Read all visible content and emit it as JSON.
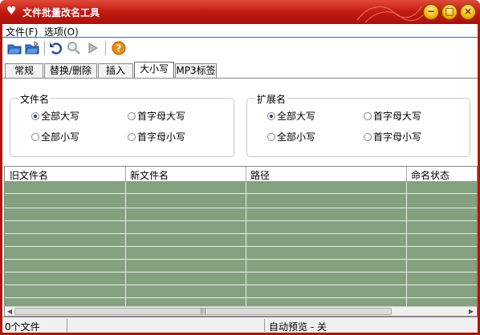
{
  "window": {
    "title": "文件批量改名工具"
  },
  "titlebar_buttons": [
    {
      "name": "minimize-button",
      "glyph": "−"
    },
    {
      "name": "maximize-button",
      "glyph": "□"
    },
    {
      "name": "close-button",
      "glyph": "×"
    }
  ],
  "menu": {
    "file": "文件(F)",
    "options": "选项(O)"
  },
  "toolbar": {
    "icons": [
      "open-folder-icon",
      "open-folder-icon",
      "undo-icon",
      "search-icon",
      "play-icon",
      "help-icon"
    ]
  },
  "tabs": [
    "常规",
    "替换/删除",
    "插入",
    "大小写",
    "MP3标签"
  ],
  "active_tab": "大小写",
  "filename_group": {
    "title": "文件名",
    "options": {
      "all_upper": "全部大写",
      "first_upper": "首字母大写",
      "all_lower": "全部小写",
      "first_lower": "首字母小写"
    },
    "selected": "全部大写"
  },
  "extension_group": {
    "title": "扩展名",
    "options": {
      "all_upper": "全部大写",
      "first_upper": "首字母大写",
      "all_lower": "全部小写",
      "first_lower": "首字母小写"
    },
    "selected": "全部大写"
  },
  "grid": {
    "columns": [
      "旧文件名",
      "新文件名",
      "路径",
      "命名状态"
    ],
    "rows": []
  },
  "status": {
    "file_count": "0个文件",
    "auto_preview": "自动预览 - 关"
  },
  "colors": {
    "titlebar": "#c21a10",
    "grid_background": "#83a07f",
    "menu_underline": "#4060d0"
  }
}
